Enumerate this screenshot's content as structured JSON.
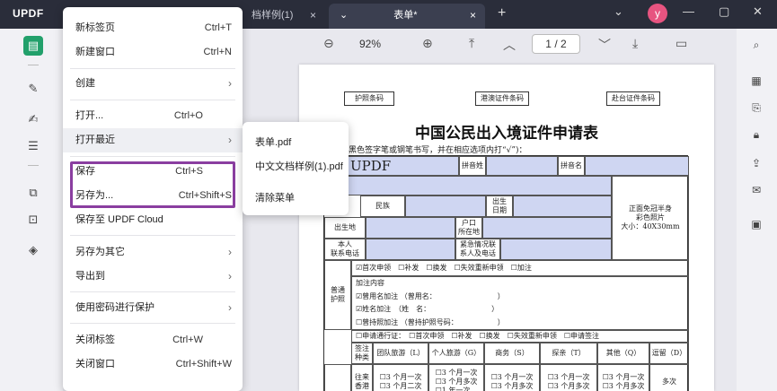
{
  "app": {
    "logo": "UPDF"
  },
  "tabs": [
    {
      "label": "档样例(1)",
      "close": "×"
    },
    {
      "label": "表单*",
      "close": "×"
    }
  ],
  "titlebar": {
    "new_tab": "+",
    "dropdown": "⌄",
    "avatar": "y",
    "min": "—",
    "max": "▢",
    "close": "✕"
  },
  "toolbar": {
    "zoom_out": "⊖",
    "zoom": "92%",
    "zoom_in": "⊕",
    "page_current": "1",
    "page_sep": "/",
    "page_total": "2"
  },
  "menu": {
    "items": [
      {
        "label": "新标签页",
        "shortcut": "Ctrl+T"
      },
      {
        "label": "新建窗口",
        "shortcut": "Ctrl+N"
      },
      {
        "label": "创建",
        "arrow": "›"
      },
      {
        "label": "打开...",
        "shortcut": "Ctrl+O"
      },
      {
        "label": "打开最近",
        "arrow": "›"
      },
      {
        "label": "保存",
        "shortcut": "Ctrl+S"
      },
      {
        "label": "另存为...",
        "shortcut": "Ctrl+Shift+S"
      },
      {
        "label": "保存至 UPDF Cloud"
      },
      {
        "label": "另存为其它",
        "arrow": "›"
      },
      {
        "label": "导出到",
        "arrow": "›"
      },
      {
        "label": "使用密码进行保护",
        "arrow": "›"
      },
      {
        "label": "关闭标签",
        "shortcut": "Ctrl+W"
      },
      {
        "label": "关闭窗口",
        "shortcut": "Ctrl+Shift+W"
      }
    ]
  },
  "recent": {
    "items": [
      "表单.pdf",
      "中文文档样例(1).pdf",
      "清除菜单"
    ]
  },
  "document": {
    "barcodes": [
      "护照条码",
      "港澳证件条码",
      "赴台证件条码"
    ],
    "title": "中国公民出入境证件申请表",
    "note": "黑色签字笔或钢笔书写，并在相应选项内打“√”)：",
    "name_value": "UPDF",
    "labels": {
      "pinyin_xing": "拼音姓",
      "pinyin_ming": "拼音名",
      "minzu": "民族",
      "chusheng_riqi": "出生\n日期",
      "chushengdi": "出生地",
      "hukou": "户口\n所在地",
      "benren": "本人\n联系电话",
      "jinji": "紧急情况联\n系人及电话",
      "photo": "正面免冠半身\n彩色照片\n大小：40X30mm",
      "putong": "普通\n护照",
      "qianzhu": "签注\n种类",
      "wanglai": "往来\n香港"
    },
    "passport_options": "☑首次申领　☐补发　☐换发　☐失效重新申领　☐加注",
    "jiazhu": [
      "加注内容",
      "☑曾用名加注 （曾用名：　　　　　　　　　）",
      "☑姓名加注　（姓　名：　　　　　　　　　）",
      "☐曾持照加注 （曾持护照号码：　　　　　　）"
    ],
    "hk_row": "☐申请通行证：　☐首次申领　☐补发　☐换发　☐失效重新申领　☐申请签注",
    "visa_types": [
      "团队旅游（L）",
      "个人旅游（G）",
      "商务（S）",
      "探亲（T）",
      "其他（Q）",
      "逗留（D）"
    ],
    "visa_rows": [
      "☐3 个月一次\n☐3 个月二次",
      "☐3 个月一次\n☐3 个月多次\n☐1 年一次",
      "☐3 个月一次\n☐3 个月多次",
      "☐3 个月一次\n☐3 个月多次",
      "☐3 个月一次\n☐3 个月多次",
      "多次"
    ]
  }
}
